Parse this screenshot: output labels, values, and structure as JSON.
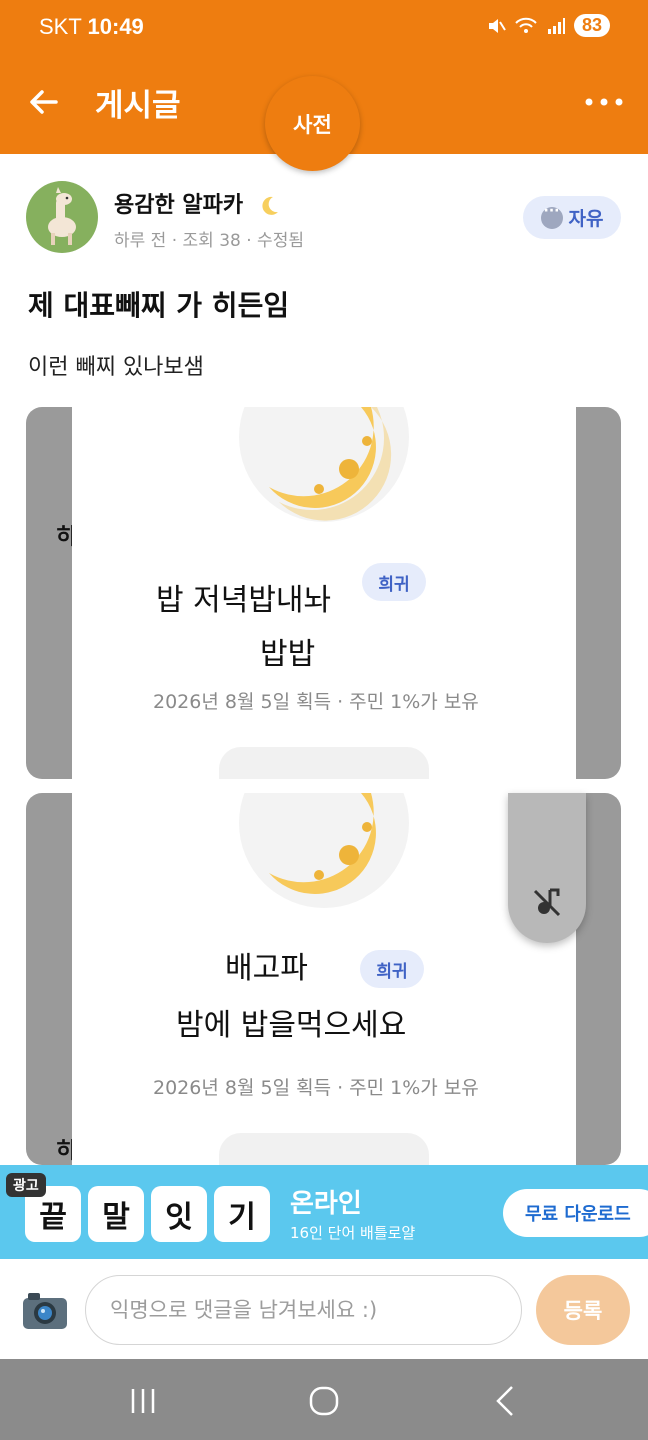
{
  "status_bar": {
    "carrier": "SKT",
    "time": "10:49",
    "battery": "83"
  },
  "app_bar": {
    "title": "게시글",
    "dict_button": "사전"
  },
  "post": {
    "author": "용감한 알파카",
    "meta": "하루 전 · 조회 38 · 수정됨",
    "category": "자유",
    "title": "제 대표빼찌 가 히든임",
    "body": "이런 빼찌 있나보샘"
  },
  "images": [
    {
      "badge_title_line1": "밥 저녁밥내놔",
      "badge_title_line2": "밥밥",
      "rarity": "희귀",
      "acquired": "2026년 8월 5일 획득 · 주민 1%가 보유",
      "side_text": "히"
    },
    {
      "badge_title_line1": "배고파",
      "badge_title_line2": "밤에 밥을먹으세요",
      "rarity": "희귀",
      "acquired": "2026년 8월 5일 획득 · 주민 1%가 보유",
      "side_text": "히"
    }
  ],
  "ad": {
    "label": "광고",
    "tiles": [
      "끝",
      "말",
      "잇",
      "기"
    ],
    "title": "온라인",
    "subtitle": "16인 단어 배틀로얄",
    "button": "무료 다운로드"
  },
  "comment": {
    "placeholder": "익명으로 댓글을 남겨보세요 :)",
    "submit": "등록"
  },
  "colors": {
    "brand": "#ee7d10",
    "tag_bg": "#e6ecfb",
    "tag_text": "#3f62c5",
    "ad_bg": "#5bc8ee"
  }
}
